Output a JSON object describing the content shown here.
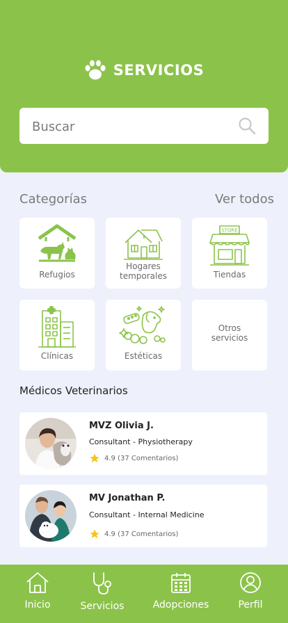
{
  "header": {
    "title": "SERVICIOS"
  },
  "search": {
    "placeholder": "Buscar"
  },
  "categories": {
    "title": "Categorías",
    "see_all": "Ver todos",
    "items": [
      {
        "label": "Refugios",
        "icon": "shelter-icon"
      },
      {
        "label": "Hogares temporales",
        "icon": "house-icon"
      },
      {
        "label": "Tiendas",
        "icon": "store-icon"
      },
      {
        "label": "Clínicas",
        "icon": "clinic-icon"
      },
      {
        "label": "Estéticas",
        "icon": "grooming-icon"
      },
      {
        "label": "Otros servicios",
        "icon": ""
      }
    ],
    "store_sign": "STORE"
  },
  "vets": {
    "title": "Médicos Veterinarios",
    "items": [
      {
        "name": "MVZ Olivia J.",
        "role": "Consultant - Physiotherapy",
        "rating": "4.9 (37 Comentarios)"
      },
      {
        "name": "MV Jonathan P.",
        "role": "Consultant - Internal Medicine",
        "rating": "4.9 (37 Comentarios)"
      }
    ]
  },
  "tabs": [
    {
      "label": "Inicio",
      "icon": "home-icon"
    },
    {
      "label": "Servicios",
      "icon": "stethoscope-icon"
    },
    {
      "label": "Adopciones",
      "icon": "calendar-icon"
    },
    {
      "label": "Perfil",
      "icon": "user-icon"
    }
  ],
  "colors": {
    "primary": "#8bc34a",
    "background": "#eef1fb",
    "star": "#f5c518"
  }
}
